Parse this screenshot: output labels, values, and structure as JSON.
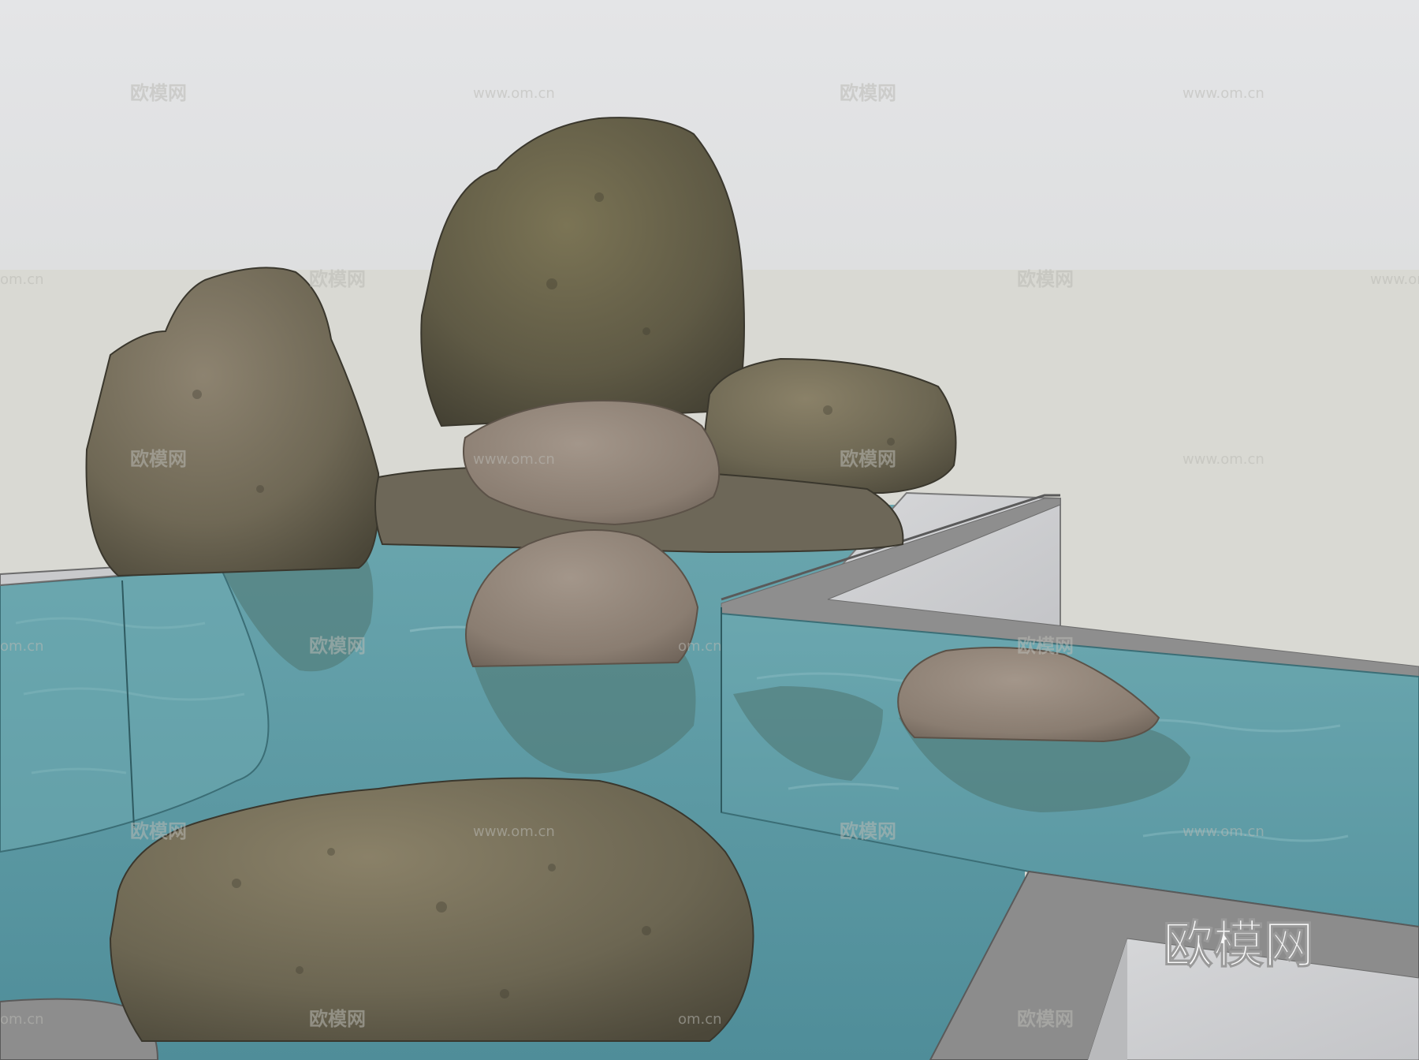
{
  "scene": {
    "subject": "rock garden with water pool",
    "colors": {
      "sky": "#e2e3e5",
      "ground": "#d9d9d2",
      "water": "#5f9ea8",
      "concrete": "#cfd0d2",
      "concrete_edge": "#8a8a8a",
      "rock_dark": "#5d5a49",
      "rock_light": "#8f8374"
    }
  },
  "watermark": {
    "brand": "欧模网",
    "url": "www.om.cn",
    "url_fragment": "om.cn",
    "corner_logo": "欧模网"
  }
}
